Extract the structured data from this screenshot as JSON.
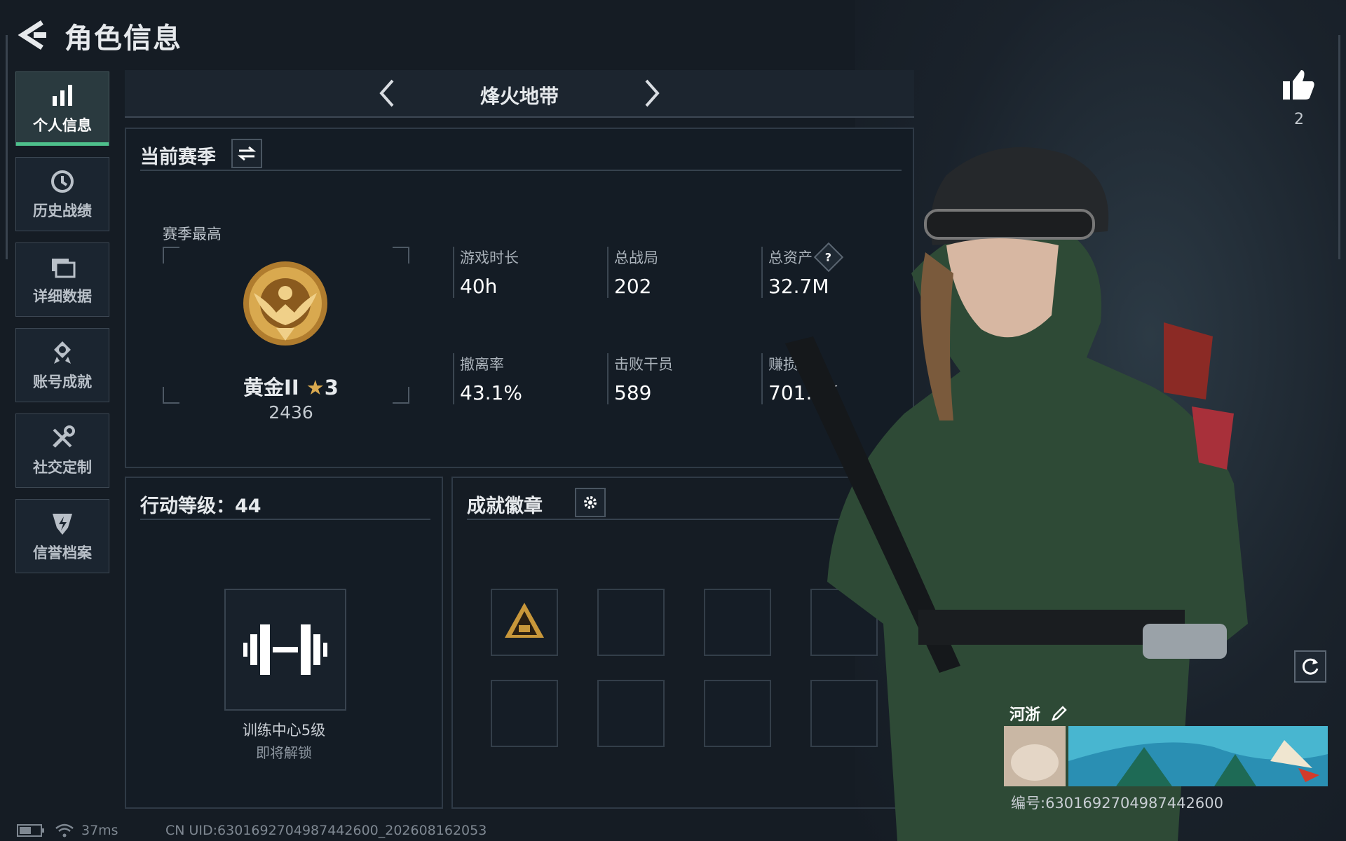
{
  "header": {
    "title": "角色信息"
  },
  "sidebar": {
    "items": [
      {
        "label": "个人信息",
        "icon": "bar-chart-icon",
        "active": true
      },
      {
        "label": "历史战绩",
        "icon": "history-clock-icon"
      },
      {
        "label": "详细数据",
        "icon": "folder-stack-icon"
      },
      {
        "label": "账号成就",
        "icon": "achievement-medal-icon"
      },
      {
        "label": "社交定制",
        "icon": "tools-wrench-icon"
      },
      {
        "label": "信誉档案",
        "icon": "shield-lightning-icon"
      }
    ]
  },
  "mode": {
    "title": "烽火地带"
  },
  "season": {
    "title": "当前赛季",
    "best_label": "赛季最高",
    "rank_name": "黄金II",
    "rank_stars": "3",
    "rank_score": "2436",
    "stats": [
      {
        "label": "游戏时长",
        "value": "40h"
      },
      {
        "label": "总战局",
        "value": "202"
      },
      {
        "label": "总资产",
        "value": "32.7M",
        "help": "?"
      },
      {
        "label": "撤离率",
        "value": "43.1%"
      },
      {
        "label": "击败干员",
        "value": "589"
      },
      {
        "label": "赚损比",
        "value": "701.5K"
      }
    ]
  },
  "action_level": {
    "title": "行动等级：44",
    "training_name": "训练中心5级",
    "training_status": "即将解锁"
  },
  "badges": {
    "title": "成就徽章"
  },
  "profile": {
    "likes": "2",
    "card_name": "河浙",
    "card_id": "编号:6301692704987442600"
  },
  "footer": {
    "ping": "37ms",
    "uid": "CN UID:6301692704987442600_202608162053"
  },
  "colors": {
    "accent": "#4ec08c",
    "background": "#151c24",
    "panel": "#141c25",
    "gold": "#c8973a"
  }
}
